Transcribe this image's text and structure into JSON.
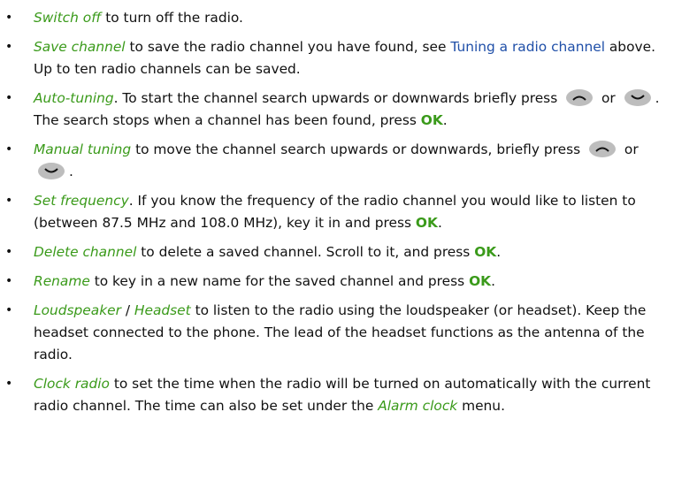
{
  "items": [
    {
      "term": "Switch off",
      "text": " to turn off the radio."
    },
    {
      "term": "Save channel",
      "text1": " to save the radio channel you have found, see ",
      "link": "Tuning a radio channel",
      "text2": " above. Up to ten radio channels can be saved."
    },
    {
      "term": "Auto-tuning",
      "text1": ". To start the channel search upwards or downwards briefly press ",
      "or": " or ",
      "text2": ". The search stops when a channel has been found, press ",
      "key": "OK",
      "end": "."
    },
    {
      "term": "Manual tuning",
      "text1": " to move the channel search upwards or downwards, briefly press ",
      "or": " or ",
      "end": "."
    },
    {
      "term": "Set frequency",
      "text1": ". If you know the frequency of the radio channel you would like to listen to (between 87.5 MHz and 108.0 MHz), key it in and press ",
      "key": "OK",
      "end": "."
    },
    {
      "term": "Delete channel",
      "text1": " to delete a saved channel. Scroll to it, and press ",
      "key": "OK",
      "end": "."
    },
    {
      "term": "Rename",
      "text1": " to key in a new name for the saved channel and press ",
      "key": "OK",
      "end": "."
    },
    {
      "term": "Loudspeaker",
      "sep": " / ",
      "term2": "Headset",
      "text1": " to listen to the radio using the loudspeaker (or headset). Keep the headset connected to the phone. The lead of the headset functions as the antenna of the radio."
    },
    {
      "term": "Clock radio",
      "text1": " to set the time when the radio will be turned on automatically with the current radio channel. The time can also be set under the ",
      "term2": "Alarm clock",
      "text2": " menu."
    }
  ],
  "bullet_char": "•",
  "icons": {
    "scroll_up": "scroll-up-key-icon",
    "scroll_down": "scroll-down-key-icon"
  },
  "colors": {
    "term": "#3a9a1a",
    "link": "#1f4fa8",
    "key": "#3a9a1a",
    "text": "#111111"
  }
}
